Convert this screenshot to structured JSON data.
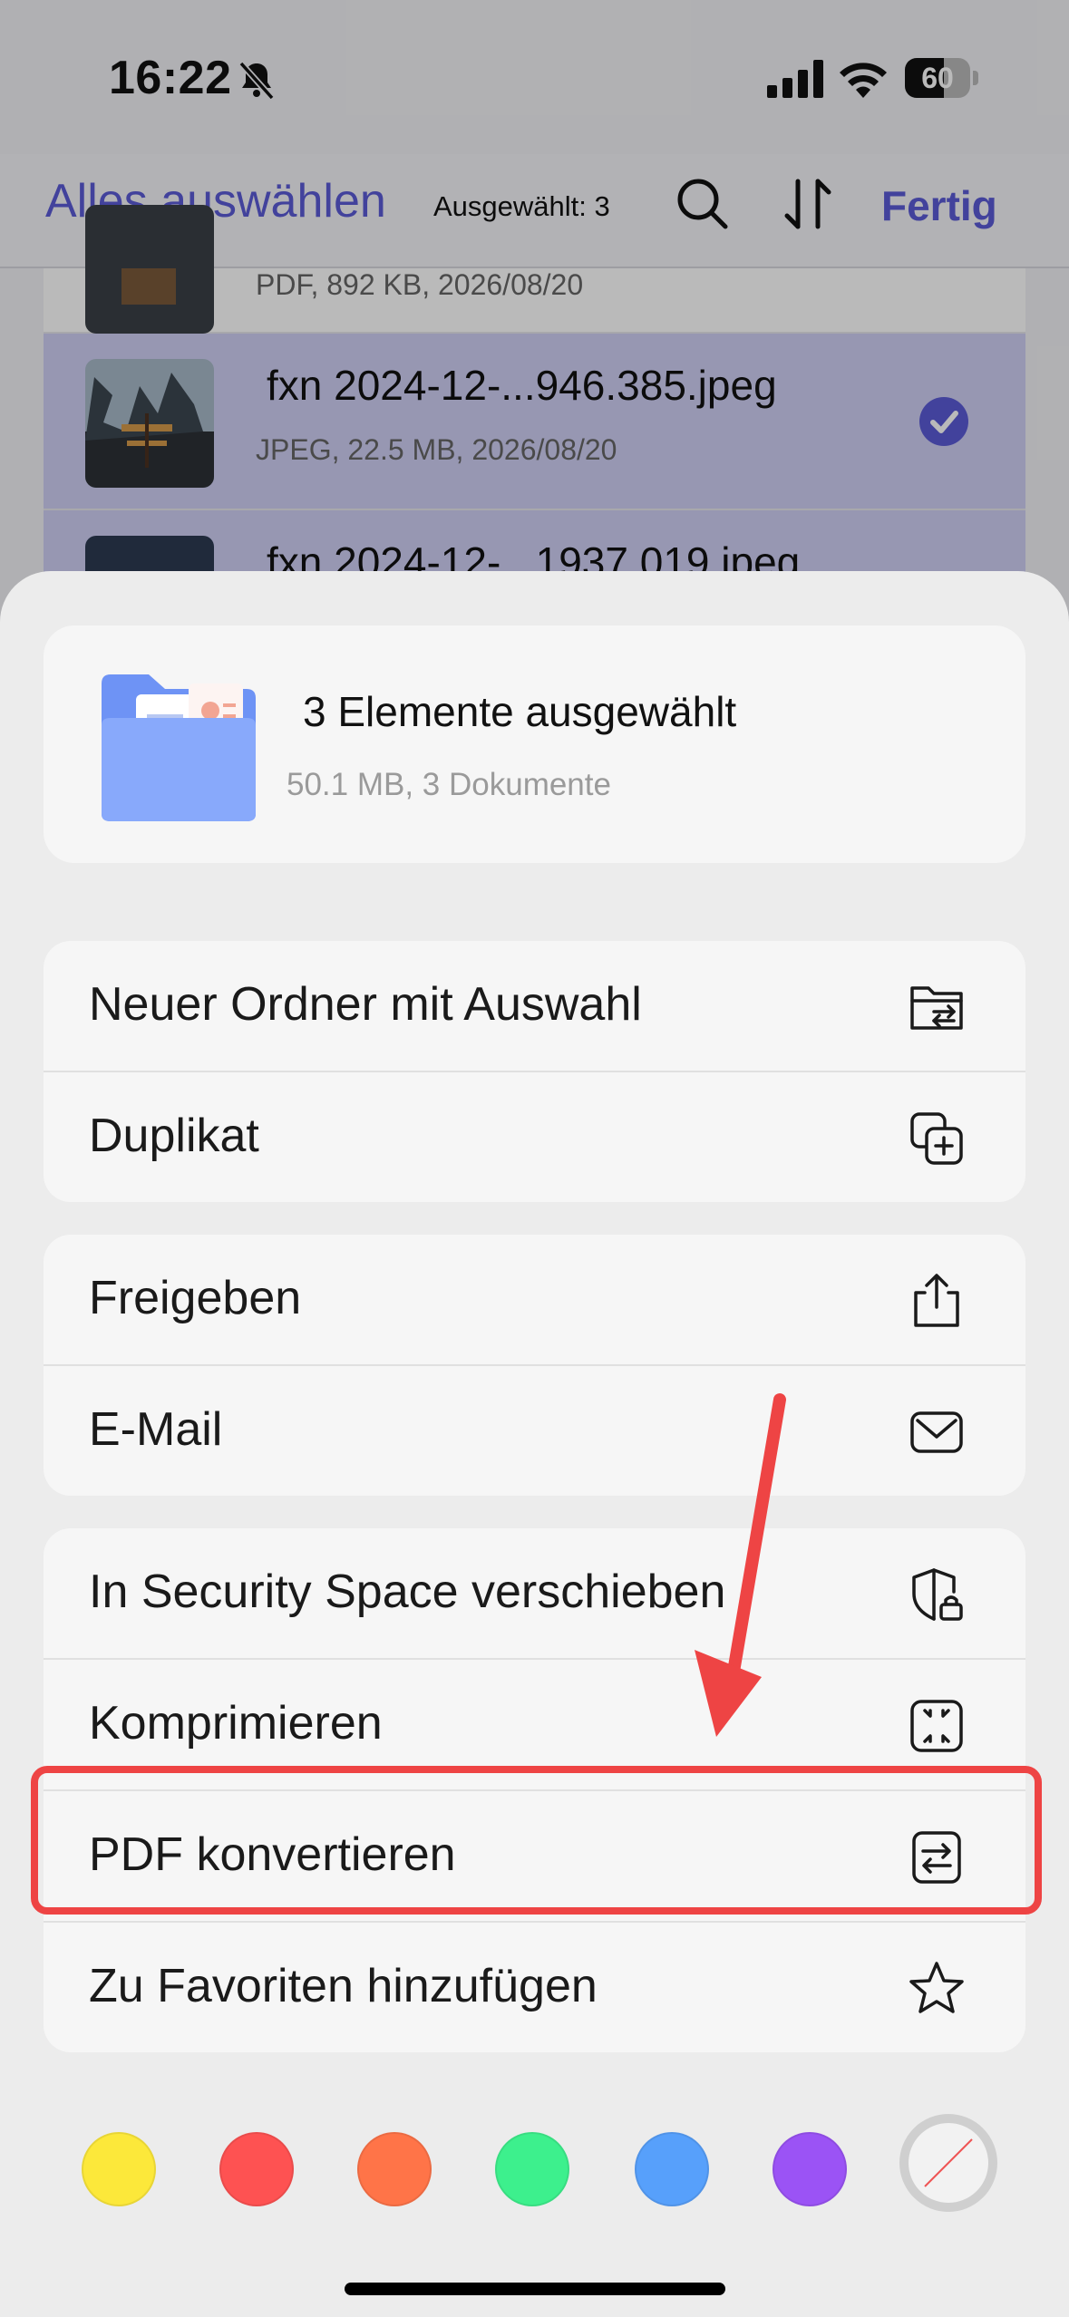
{
  "status_bar": {
    "time": "16:22",
    "battery": "60",
    "battery_level": 0.6
  },
  "navbar": {
    "select_all": "Alles auswählen",
    "selected_count": "Ausgewählt: 3",
    "done": "Fertig"
  },
  "files": [
    {
      "name": "",
      "meta": "PDF, 892 KB, 2026/08/20",
      "selected": false
    },
    {
      "name": "fxn 2024-12-...946.385.jpeg",
      "meta": "JPEG, 22.5 MB, 2026/08/20",
      "selected": true
    },
    {
      "name": "fxn 2024-12-...1937.019.jpeg",
      "meta": "",
      "selected": true
    }
  ],
  "sheet": {
    "summary_title": "3 Elemente ausgewählt",
    "summary_sub": "50.1 MB, 3 Dokumente",
    "groups": [
      [
        {
          "label": "Neuer Ordner mit Auswahl",
          "icon": "folder-transfer-icon"
        },
        {
          "label": "Duplikat",
          "icon": "duplicate-icon"
        }
      ],
      [
        {
          "label": "Freigeben",
          "icon": "share-icon"
        },
        {
          "label": "E-Mail",
          "icon": "mail-icon"
        }
      ],
      [
        {
          "label": "In Security Space verschieben",
          "icon": "shield-lock-icon"
        },
        {
          "label": "Komprimieren",
          "icon": "compress-icon"
        },
        {
          "label": "PDF konvertieren",
          "icon": "convert-icon"
        },
        {
          "label": "Zu Favoriten hinzufügen",
          "icon": "star-icon"
        }
      ]
    ],
    "color_tags": [
      "#fce83a",
      "#fe5252",
      "#ff7448",
      "#3df08d",
      "#57a0fb",
      "#9b53f5"
    ]
  },
  "colors": {
    "accent": "#5b5bd6",
    "annotation": "#ee4444"
  }
}
